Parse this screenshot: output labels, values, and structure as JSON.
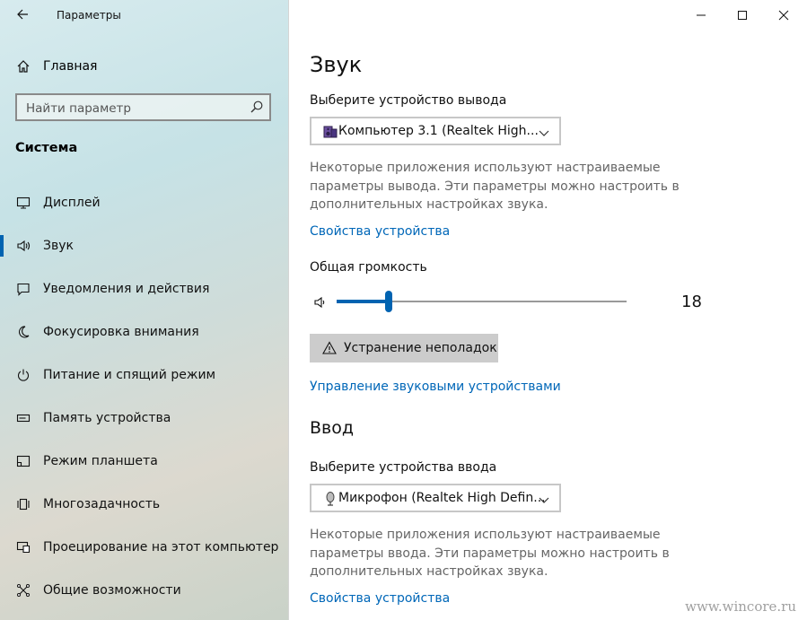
{
  "window": {
    "title": "Параметры"
  },
  "sidebar": {
    "home_label": "Главная",
    "search_placeholder": "Найти параметр",
    "section_title": "Система",
    "items": [
      {
        "label": "Дисплей",
        "icon": "display-icon"
      },
      {
        "label": "Звук",
        "icon": "speaker-icon",
        "active": true
      },
      {
        "label": "Уведомления и действия",
        "icon": "notification-icon"
      },
      {
        "label": "Фокусировка внимания",
        "icon": "moon-icon"
      },
      {
        "label": "Питание и спящий режим",
        "icon": "power-icon"
      },
      {
        "label": "Память устройства",
        "icon": "storage-icon"
      },
      {
        "label": "Режим планшета",
        "icon": "tablet-icon"
      },
      {
        "label": "Многозадачность",
        "icon": "multitask-icon"
      },
      {
        "label": "Проецирование на этот компьютер",
        "icon": "projection-icon"
      },
      {
        "label": "Общие возможности",
        "icon": "shared-icon"
      }
    ]
  },
  "main": {
    "title": "Звук",
    "output": {
      "label": "Выберите устройство вывода",
      "device": "Компьютер 3.1 (Realtek High...",
      "description": "Некоторые приложения используют настраиваемые параметры вывода. Эти параметры можно настроить в дополнительных настройках звука.",
      "device_props_link": "Свойства устройства"
    },
    "volume": {
      "label": "Общая громкость",
      "value": "18",
      "level_percent": 18
    },
    "troubleshoot_button": "Устранение неполадок",
    "manage_link": "Управление звуковыми устройствами",
    "input": {
      "title": "Ввод",
      "label": "Выберите устройства ввода",
      "device": "Микрофон (Realtek High Defin...",
      "description": "Некоторые приложения используют настраиваемые параметры ввода. Эти параметры можно настроить в дополнительных настройках звука.",
      "device_props_link": "Свойства устройства"
    }
  },
  "watermark": "www.wincore.ru",
  "colors": {
    "accent": "#0063b1",
    "link": "#0067b8"
  }
}
